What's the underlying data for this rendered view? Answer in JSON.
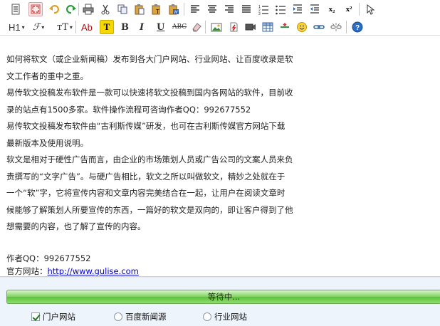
{
  "toolbar": {
    "heading_label": "H1",
    "font_label": "ℱ",
    "size_label": "ᴛT",
    "color_label": "Ab",
    "bold_label": "B",
    "italic_label": "I",
    "underline_label": "U",
    "strike_label": "ABC",
    "subscript_label": "x₂",
    "superscript_label": "x²"
  },
  "editor": {
    "paragraphs": [
      "如何将软文（或企业新闻稿）发布到各大门户网站、行业网站、让百度收录是软",
      "文工作者的重中之重。",
      "易传软文投稿发布软件是一款可以快速将软文投稿到国内各网站的软件，目前收",
      "录的站点有1500多家。软件操作流程可咨询作者QQ：992677552",
      "易传软文投稿发布软件由“古利斯传媒”研发，也可在古利斯传媒官方网站下载",
      "最新版本及使用说明。",
      "软文是相对于硬性广告而言，由企业的市场策划人员或广告公司的文案人员来负",
      "责撰写的“文字广告”。与硬广告相比，软文之所以叫做软文，精妙之处就在于",
      "一个“软”字，它将宣传内容和文章内容完美结合在一起，让用户在阅读文章时",
      "候能够了解策划人所要宣传的东西，一篇好的软文是双向的，即让客户得到了他",
      "想需要的内容，也了解了宣传的内容。"
    ],
    "author_line": "作者QQ：992677552",
    "site_prefix": "官方网站：",
    "site_link": "http://www.gulise.com"
  },
  "progress": {
    "text": "等待中...",
    "value": 1.0
  },
  "options": [
    {
      "label": "门户网站",
      "type": "checkbox",
      "checked": true
    },
    {
      "label": "百度新闻源",
      "type": "radio",
      "checked": false
    },
    {
      "label": "行业网站",
      "type": "radio",
      "checked": false
    }
  ],
  "icons": [
    "source-icon",
    "fullscreen-icon",
    "undo-icon",
    "redo-icon",
    "print-icon",
    "cut-icon",
    "copy-icon",
    "paste-icon",
    "paste-text-icon",
    "paste-word-icon",
    "align-left-icon",
    "align-center-icon",
    "align-right-icon",
    "align-justify-icon",
    "ordered-list-icon",
    "unordered-list-icon",
    "indent-icon",
    "outdent-icon",
    "subscript-icon",
    "superscript-icon",
    "select-all-icon",
    "highlight-icon",
    "remove-format-icon",
    "image-icon",
    "flash-icon",
    "media-icon",
    "table-icon",
    "hr-icon",
    "emoticon-icon",
    "link-icon",
    "unlink-icon",
    "about-icon"
  ],
  "colors": {
    "link": "#0000cc",
    "progress_green": "#5cc13a",
    "bottom_bg": "#eef4fb"
  }
}
